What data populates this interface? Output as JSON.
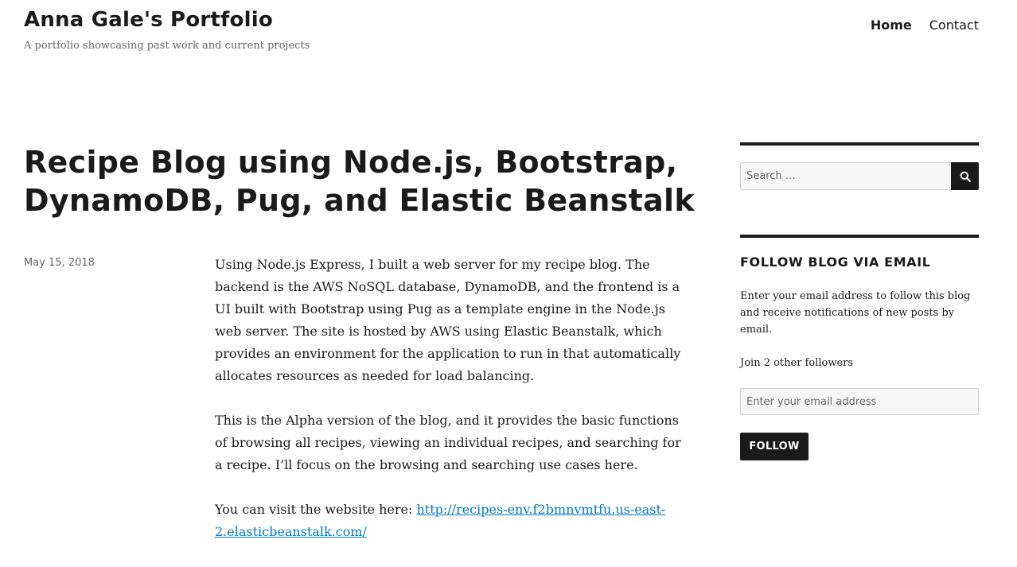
{
  "site": {
    "title": "Anna Gale's Portfolio",
    "tagline": "A portfolio showcasing past work and current projects"
  },
  "nav": {
    "items": [
      {
        "label": "Home",
        "active": true
      },
      {
        "label": "Contact",
        "active": false
      }
    ]
  },
  "post": {
    "title": "Recipe Blog using Node.js, Bootstrap, DynamoDB, Pug, and Elastic Beanstalk",
    "date": "May 15, 2018",
    "paragraphs": [
      "Using Node.js Express, I built a web server for my recipe blog. The backend is the AWS NoSQL database, DynamoDB, and the frontend is a UI built with Bootstrap using Pug as a template engine in the Node.js web server. The site is hosted by AWS using Elastic Beanstalk, which provides an environment for the application to run in that automatically allocates resources as needed for load balancing.",
      "This is the Alpha version of the blog, and it provides the basic functions of browsing all recipes, viewing an individual recipes, and searching for a recipe. I’ll focus on the browsing and searching use cases here."
    ],
    "link_intro": "You can visit the website here: ",
    "link_text": "http://recipes-env.f2bmnvmtfu.us-east-2.elasticbeanstalk.com/"
  },
  "sidebar": {
    "search": {
      "placeholder": "Search …",
      "icon": "search-icon"
    },
    "follow": {
      "heading": "Follow Blog via Email",
      "description": "Enter your email address to follow this blog and receive notifications of new posts by email.",
      "followers": "Join 2 other followers",
      "email_placeholder": "Enter your email address",
      "button_label": "Follow"
    }
  },
  "colors": {
    "text": "#1a1a1a",
    "muted": "#686868",
    "link": "#007acc",
    "border": "#d1d1d1",
    "field_bg": "#f7f7f7"
  }
}
